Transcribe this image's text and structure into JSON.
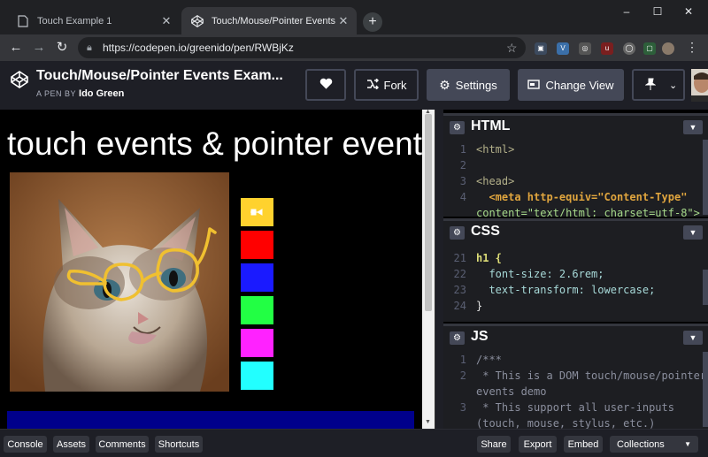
{
  "browser": {
    "tabs": [
      {
        "title": "Touch Example 1",
        "active": false
      },
      {
        "title": "Touch/Mouse/Pointer Events Exa",
        "active": true
      }
    ],
    "new_tab": "+",
    "window_controls": [
      "–",
      "☐",
      "✕"
    ],
    "url": "https://codepen.io/greenido/pen/RWBjKz"
  },
  "header": {
    "title": "Touch/Mouse/Pointer Events Exam...",
    "by_prefix": "A PEN BY",
    "author": "Ido Green",
    "buttons": {
      "fork": "Fork",
      "settings": "Settings",
      "change_view": "Change View"
    }
  },
  "preview": {
    "heading": "touch events & pointer events",
    "swatches": [
      "#ffd22e",
      "#ff0000",
      "#1a1aff",
      "#22ff44",
      "#ff22ff",
      "#22ffff"
    ],
    "accent": "#00008b"
  },
  "editors": {
    "html": {
      "name": "HTML",
      "lines": [
        {
          "n": "1",
          "text": "<html>"
        },
        {
          "n": "2",
          "text": ""
        },
        {
          "n": "3",
          "text": "<head>"
        },
        {
          "n": "4",
          "text": "  <meta http-equiv=\"Content-Type\""
        },
        {
          "n": "",
          "text": "content=\"text/html; charset=utf-8\">"
        }
      ]
    },
    "css": {
      "name": "CSS",
      "lines": [
        {
          "n": "21",
          "text": "h1 {"
        },
        {
          "n": "22",
          "text": "  font-size: 2.6rem;"
        },
        {
          "n": "23",
          "text": "  text-transform: lowercase;"
        },
        {
          "n": "24",
          "text": "}"
        }
      ]
    },
    "js": {
      "name": "JS",
      "lines": [
        {
          "n": "1",
          "text": "/***"
        },
        {
          "n": "2",
          "text": " * This is a DOM touch/mouse/pointer"
        },
        {
          "n": "",
          "text": "events demo"
        },
        {
          "n": "3",
          "text": " * This support all user-inputs"
        },
        {
          "n": "",
          "text": "(touch, mouse, stylus, etc.)"
        }
      ]
    }
  },
  "bottom": {
    "left": [
      "Console",
      "Assets",
      "Comments",
      "Shortcuts"
    ],
    "right": [
      "Share",
      "Export",
      "Embed",
      "Collections"
    ]
  }
}
